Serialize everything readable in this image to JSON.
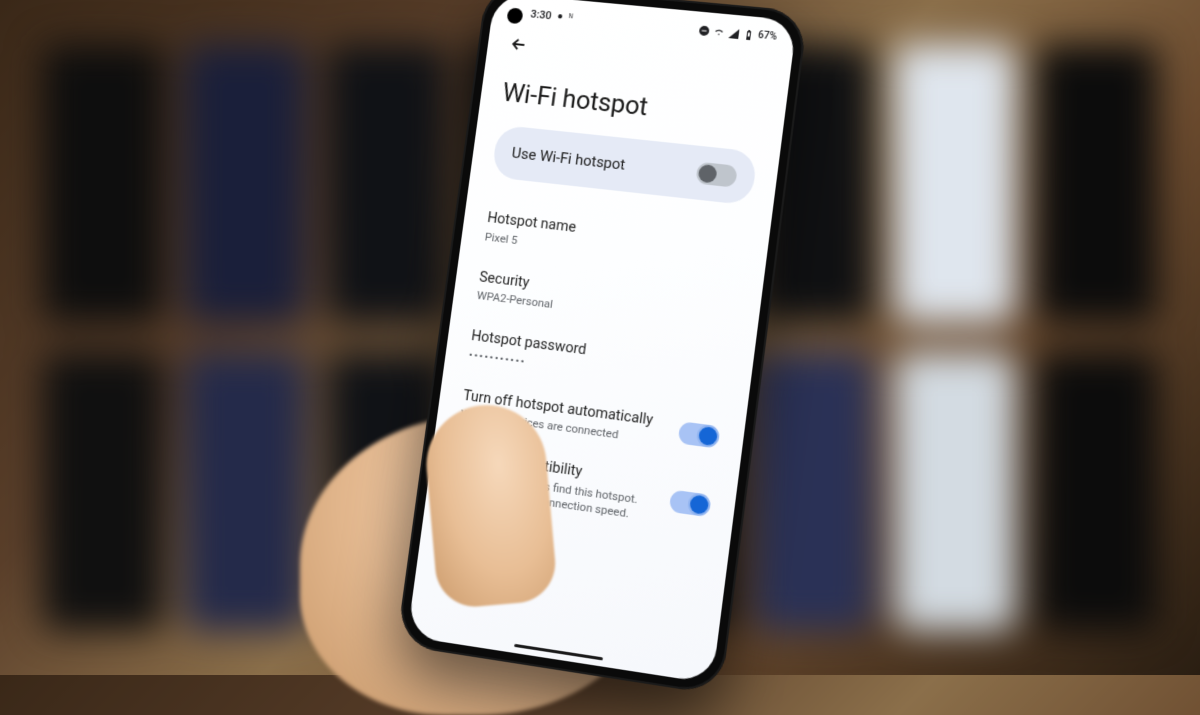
{
  "status": {
    "time": "3:30",
    "battery": "67%"
  },
  "page": {
    "title": "Wi-Fi hotspot"
  },
  "hero": {
    "label": "Use Wi-Fi hotspot",
    "enabled": false
  },
  "settings": {
    "hotspot_name": {
      "label": "Hotspot name",
      "value": "Pixel 5"
    },
    "security": {
      "label": "Security",
      "value": "WPA2-Personal"
    },
    "password": {
      "label": "Hotspot password",
      "value": "•••••••••••"
    },
    "auto_off": {
      "label": "Turn off hotspot automatically",
      "sub": "When no devices are connected",
      "enabled": true
    },
    "extend": {
      "label": "Extend compatibility",
      "sub": "Helps other devices find this hotspot. Reduces hotspot connection speed.",
      "enabled": true
    }
  }
}
